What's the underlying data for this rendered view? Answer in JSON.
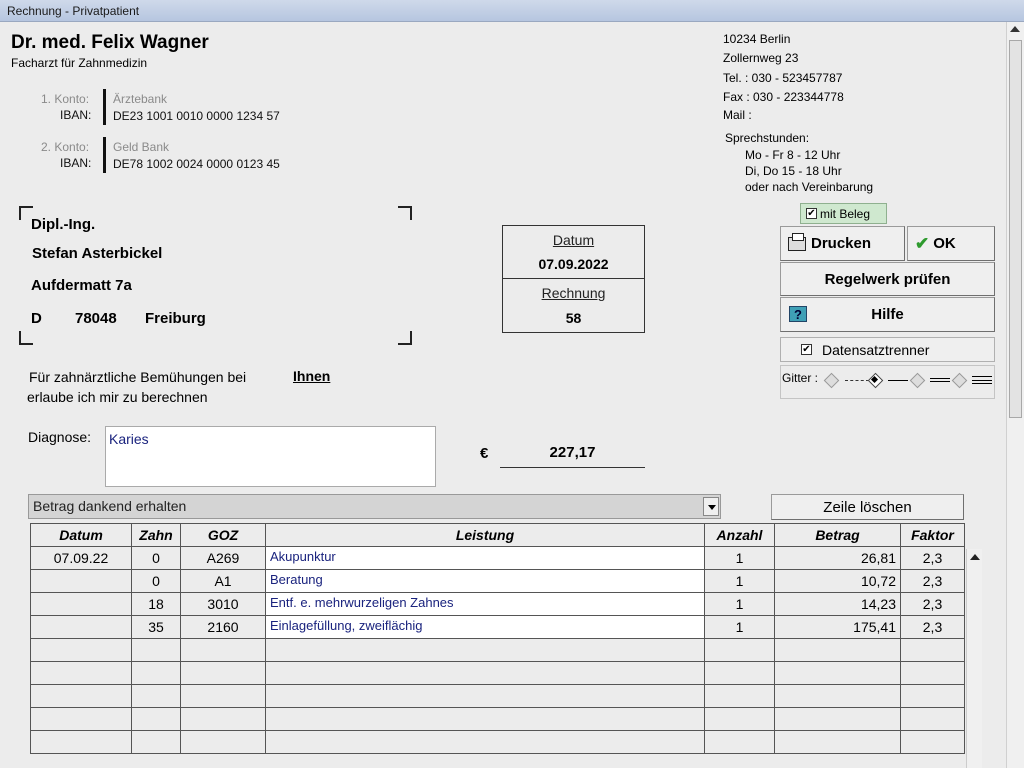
{
  "window": {
    "title": "Rechnung - Privatpatient"
  },
  "doctor": {
    "name": "Dr. med. Felix Wagner",
    "specialty": "Facharzt für Zahnmedizin",
    "accounts": [
      {
        "konto_label": "1. Konto:",
        "bank": "Ärztebank",
        "iban_label": "IBAN:",
        "iban": "DE23 1001 0010 0000 1234 57"
      },
      {
        "konto_label": "2. Konto:",
        "bank": "Geld Bank",
        "iban_label": "IBAN:",
        "iban": "DE78 1002 0024 0000 0123 45"
      }
    ],
    "address": {
      "city_line": "10234  Berlin",
      "street": "Zollernweg 23"
    },
    "contact": {
      "tel": "Tel. :   030 - 523457787",
      "fax": "Fax :   030 - 223344778",
      "mail": "Mail :"
    },
    "hours": {
      "title": "Sprechstunden:",
      "lines": [
        "Mo - Fr 8 - 12 Uhr",
        "Di, Do 15 - 18 Uhr",
        "oder nach Vereinbarung"
      ]
    }
  },
  "recipient": {
    "title": "Dipl.-Ing.",
    "name": "Stefan Asterbickel",
    "street": "Aufdermatt 7a",
    "country": "D",
    "zip": "78048",
    "city": "Freiburg"
  },
  "info_box": {
    "date_label": "Datum",
    "date": "07.09.2022",
    "invoice_label": "Rechnung",
    "invoice_no": "58"
  },
  "intro": {
    "line1": "Für zahnärztliche Bemühungen bei",
    "addressee": "Ihnen",
    "line2": "erlaube ich mir zu berechnen"
  },
  "diagnosis": {
    "label": "Diagnose:",
    "value": "Karies"
  },
  "total": {
    "currency": "€",
    "amount": "227,17"
  },
  "buttons": {
    "mit_beleg": "mit Beleg",
    "print": "Drucken",
    "ok": "OK",
    "rules": "Regelwerk prüfen",
    "help": "Hilfe",
    "help_icon": "?",
    "separator": "Datensatztrenner",
    "grid_label": "Gitter :",
    "delete_row": "Zeile löschen"
  },
  "payment_status": {
    "selected": "Betrag dankend erhalten"
  },
  "table": {
    "headers": {
      "datum": "Datum",
      "zahn": "Zahn",
      "goz": "GOZ",
      "leistung": "Leistung",
      "anzahl": "Anzahl",
      "betrag": "Betrag",
      "faktor": "Faktor"
    },
    "rows": [
      {
        "datum": "07.09.22",
        "zahn": "0",
        "goz": "A269",
        "leistung": "Akupunktur",
        "anzahl": "1",
        "betrag": "26,81",
        "faktor": "2,3"
      },
      {
        "datum": "",
        "zahn": "0",
        "goz": "A1",
        "leistung": "Beratung",
        "anzahl": "1",
        "betrag": "10,72",
        "faktor": "2,3"
      },
      {
        "datum": "",
        "zahn": "18",
        "goz": "3010",
        "leistung": "Entf. e. mehrwurzeligen Zahnes",
        "anzahl": "1",
        "betrag": "14,23",
        "faktor": "2,3"
      },
      {
        "datum": "",
        "zahn": "35",
        "goz": "2160",
        "leistung": "Einlagefüllung, zweiflächig",
        "anzahl": "1",
        "betrag": "175,41",
        "faktor": "2,3"
      }
    ]
  },
  "colors": {
    "accent_text": "#1a237e",
    "mit_beleg_bg": "#cfe8cf",
    "ok_check": "#2e9a2e"
  }
}
